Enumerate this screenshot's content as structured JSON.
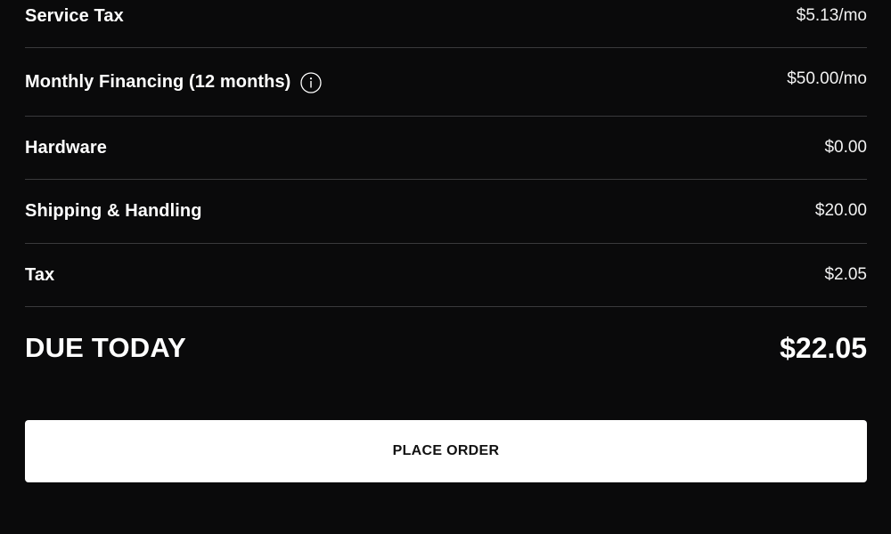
{
  "line_items": [
    {
      "label": "Service Tax",
      "value": "$5.13/mo"
    },
    {
      "label": "Monthly Financing (12 months)",
      "value": "$50.00/mo",
      "has_info_icon": true
    },
    {
      "label": "Hardware",
      "value": "$0.00"
    },
    {
      "label": "Shipping & Handling",
      "value": "$20.00"
    },
    {
      "label": "Tax",
      "value": "$2.05"
    }
  ],
  "total": {
    "label": "DUE TODAY",
    "value": "$22.05"
  },
  "actions": {
    "place_order_label": "PLACE ORDER"
  },
  "icons": {
    "financing_info": "info-icon"
  },
  "colors": {
    "background": "#0a0a0b",
    "text": "#ffffff",
    "divider": "#3a3a3c",
    "button_bg": "#ffffff",
    "button_text": "#111111"
  }
}
